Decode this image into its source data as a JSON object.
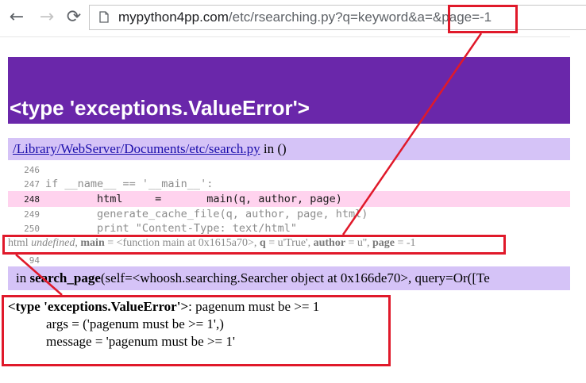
{
  "browser": {
    "back_icon": "←",
    "forward_icon": "→",
    "reload_icon": "⟳",
    "url_host": "mypython4pp.com",
    "url_path": "/etc/rsearching.py?q=keyword&a=&page=-1"
  },
  "error": {
    "title": "<type 'exceptions.ValueError'>"
  },
  "frame1": {
    "path": "/Library/WebServer/Documents/etc/search.py",
    "suffix": " in ()"
  },
  "code_lines": [
    {
      "no": "246",
      "text": ""
    },
    {
      "no": "247",
      "text": "if __name__ == '__main__':"
    },
    {
      "no": "248",
      "text": "        html     =       main(q, author, page)"
    },
    {
      "no": "249",
      "text": "        generate_cache_file(q, author, page, html)"
    },
    {
      "no": "250",
      "text": "        print \"Content-Type: text/html\""
    },
    {
      "no": "94",
      "text": ""
    }
  ],
  "vars": {
    "html": "html",
    "undefined": "undefined",
    "main_label": "main",
    "main_val": " = <function main at 0x1615a70>, ",
    "q_label": "q",
    "q_val": " = u'True', ",
    "author_label": "author",
    "author_val": " = u'', ",
    "page_label": "page",
    "page_val": " = -1"
  },
  "frame2": {
    "prefix": "in ",
    "func": "search_page",
    "args": "(self=<whoosh.searching.Searcher object at 0x166de70>, query=Or([Te"
  },
  "exception": {
    "type": "<type 'exceptions.ValueError'>",
    "message": ": pagenum must be >= 1",
    "args_line": "args = ('pagenum must be >= 1',)",
    "message_line": "message = 'pagenum must be >= 1'"
  },
  "colors": {
    "header_purple": "#6a27aa",
    "frame_lavender": "#d5c3f7",
    "highlight_pink": "#ffd3ee",
    "annotation_red": "#e0192a"
  }
}
